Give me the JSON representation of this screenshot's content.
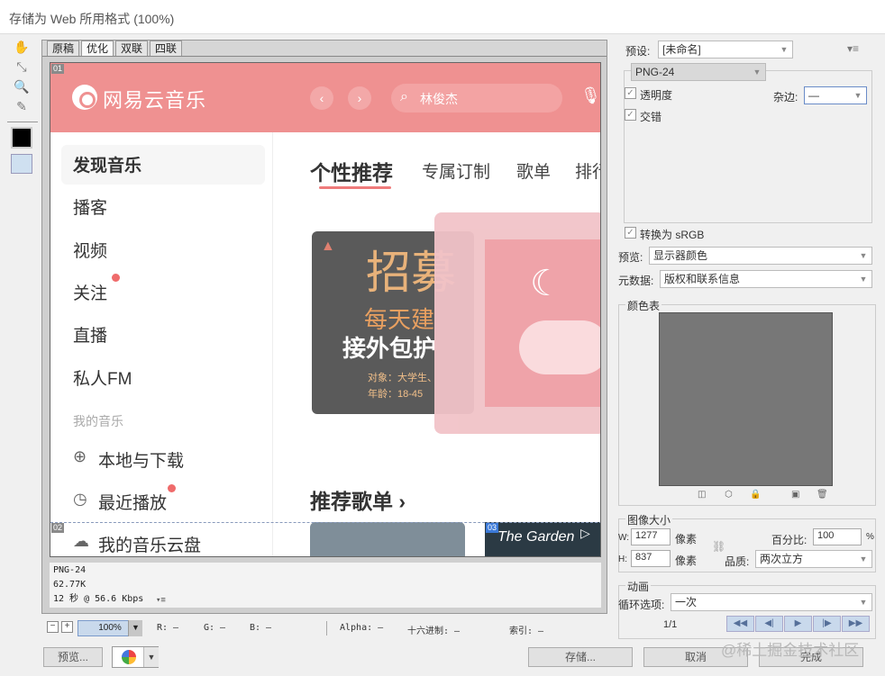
{
  "window": {
    "title": "存储为 Web 所用格式 (100%)"
  },
  "tools": {
    "hand": "✋",
    "slice_select": "⤡",
    "zoom": "🔍",
    "eyedropper": "✎"
  },
  "view_tabs": [
    "原稿",
    "优化",
    "双联",
    "四联"
  ],
  "app_preview": {
    "app_name": "网易云音乐",
    "back": "‹",
    "forward": "›",
    "search_placeholder": "林俊杰",
    "sidebar": {
      "items": [
        "发现音乐",
        "播客",
        "视频",
        "关注",
        "直播",
        "私人FM"
      ],
      "group_title": "我的音乐",
      "my_music": [
        "本地与下载",
        "最近播放",
        "我的音乐云盘"
      ]
    },
    "tabs": [
      "个性推荐",
      "专属订制",
      "歌单",
      "排行"
    ],
    "banner": {
      "big": "招募",
      "mid": "每天建",
      "line3": "接外包护",
      "sub1": "对象：大学生、",
      "sub2": "年龄：18-45"
    },
    "recommend_title": "推荐歌单 ›",
    "playlist2_text": "The Garden"
  },
  "slices": {
    "s1": "01",
    "s2": "02",
    "s3": "03"
  },
  "opt_info": {
    "format": "PNG-24",
    "size": "62.77K",
    "speed": "12 秒 @ 56.6 Kbps",
    "menu": "▾≡"
  },
  "status": {
    "zoom": "100%",
    "r": "R: —",
    "g": "G: —",
    "b": "B: —",
    "alpha": "Alpha: —",
    "hex": "十六进制: —",
    "index": "索引: —"
  },
  "buttons": {
    "preview": "预览...",
    "save": "存储...",
    "cancel": "取消",
    "done": "完成"
  },
  "watermark": "@稀土掘金技术社区",
  "settings": {
    "preset_label": "预设:",
    "preset_value": "[未命名]",
    "format_value": "PNG-24",
    "transparency_label": "透明度",
    "interlaced_label": "交错",
    "matte_label": "杂边:",
    "matte_value": "—",
    "convert_srgb_label": "转换为 sRGB",
    "preview_label": "预览:",
    "preview_value": "显示器颜色",
    "metadata_label": "元数据:",
    "metadata_value": "版权和联系信息",
    "color_table_label": "颜色表",
    "image_size_label": "图像大小",
    "w_label": "W:",
    "w_value": "1277",
    "h_label": "H:",
    "h_value": "837",
    "px_label": "像素",
    "percent_label": "百分比:",
    "percent_value": "100",
    "percent_unit": "%",
    "quality_label": "品质:",
    "quality_value": "两次立方",
    "animation_label": "动画",
    "loop_label": "循环选项:",
    "loop_value": "一次",
    "frame_counter": "1/1"
  },
  "colors": {
    "accent": "#ef9191",
    "selection": "#c9d9ec"
  }
}
